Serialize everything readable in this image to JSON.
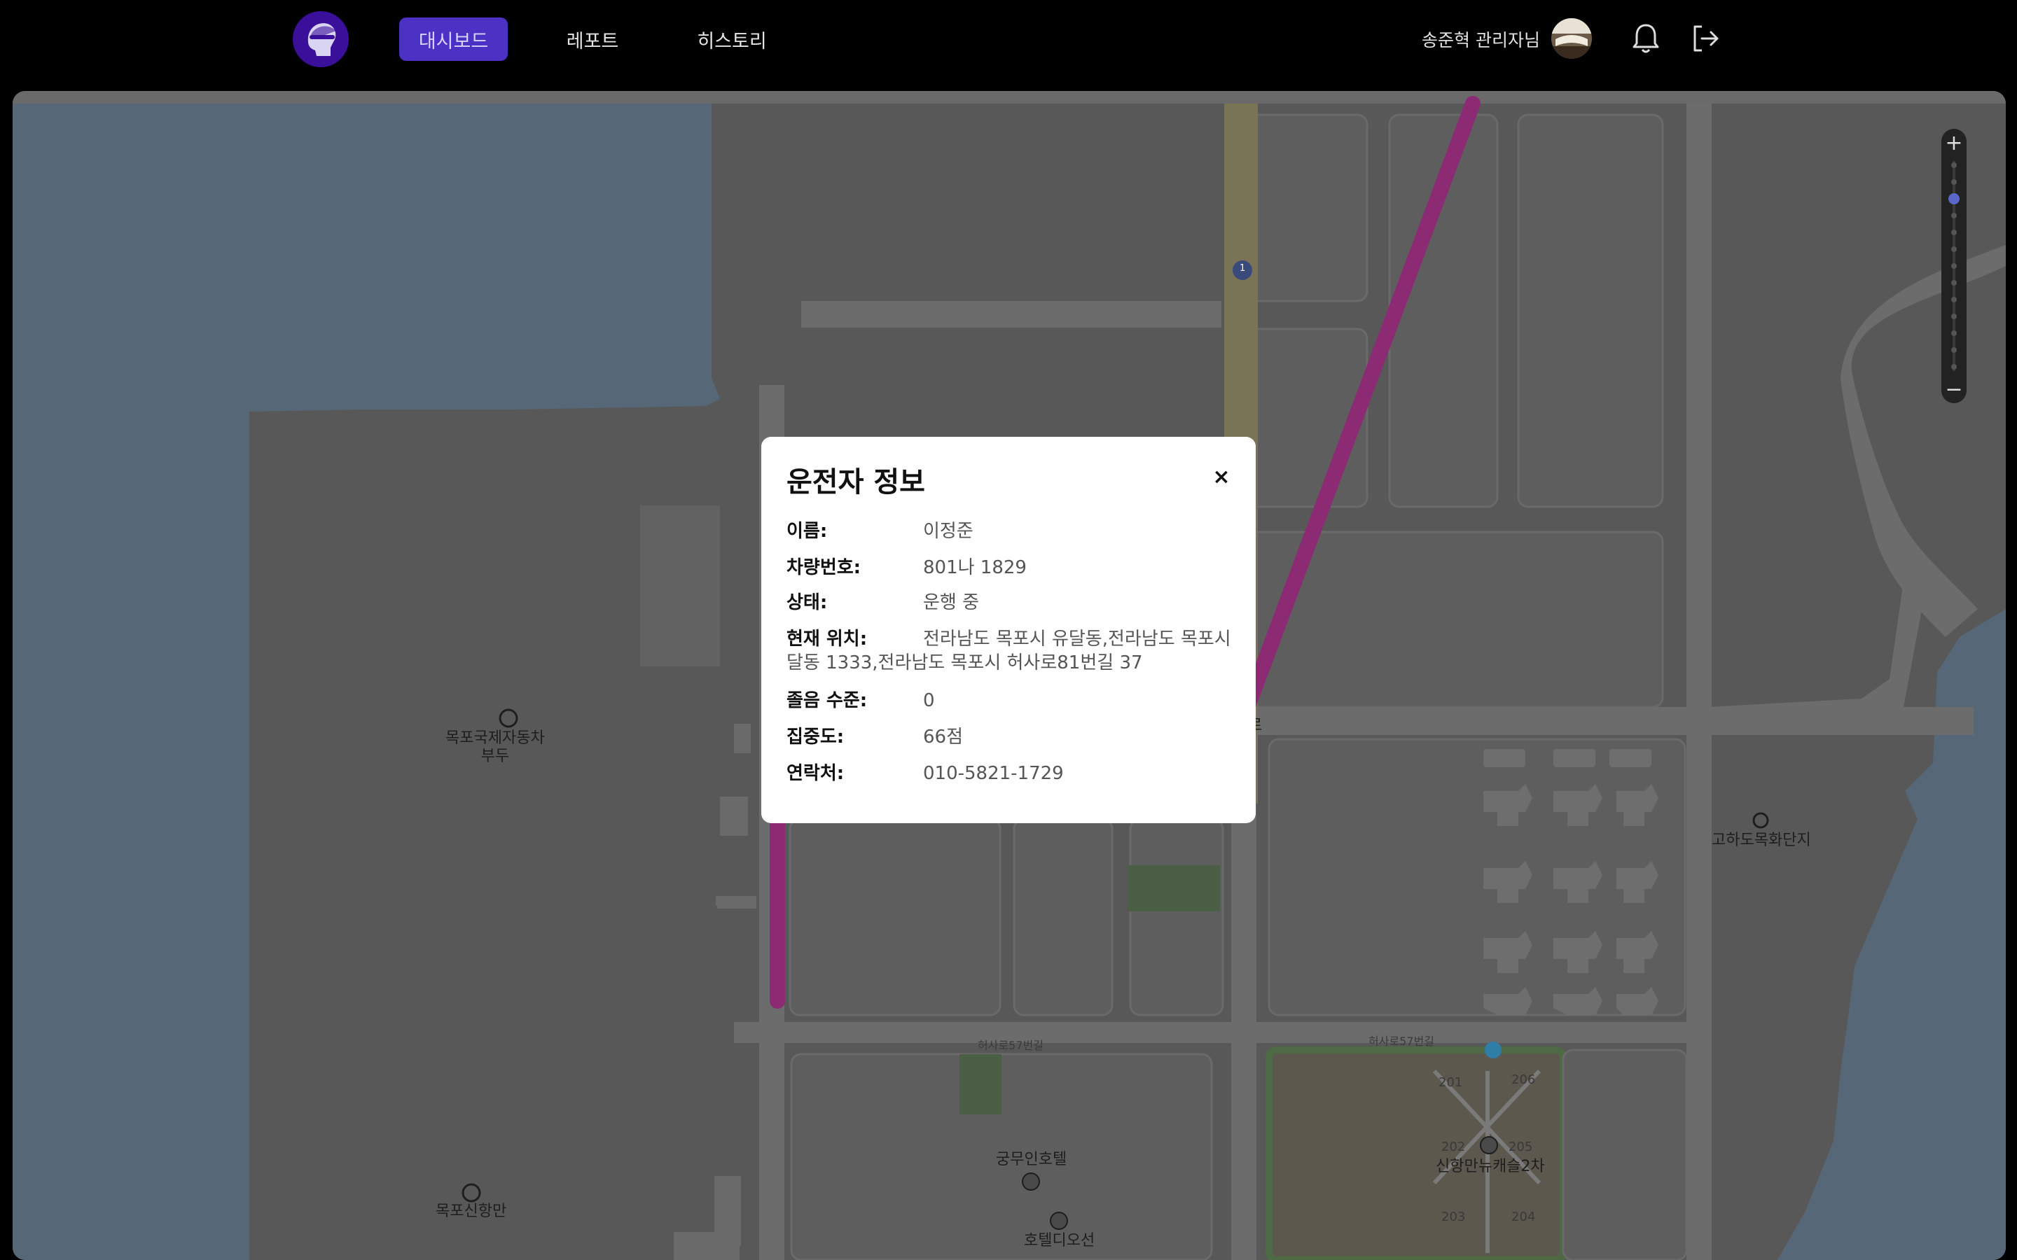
{
  "header": {
    "nav": [
      "대시보드",
      "레포트",
      "히스토리"
    ],
    "user_name": "송준혁 관리자님"
  },
  "map": {
    "labels": {
      "pier": "목포국제자동차\n부두",
      "port": "목포신항만",
      "complex": "고하도목화단지",
      "hotel1": "궁무인호텔",
      "hotel2": "호텔디오선",
      "apt": "신항만뉴캐슬2차",
      "street1": "허사로57번길",
      "street2": "허사로57번길",
      "road_frag": "로",
      "bldg_201": "201",
      "bldg_206": "206",
      "bldg_202": "202",
      "bldg_205": "205",
      "bldg_203": "203",
      "bldg_204": "204",
      "road_num": "1"
    },
    "zoom": {
      "plus": "+",
      "minus": "−"
    }
  },
  "modal": {
    "title": "운전자 정보",
    "close": "×",
    "fields": {
      "name_label": "이름:",
      "name_value": "이정준",
      "plate_label": "차량번호:",
      "plate_value": "801나 1829",
      "status_label": "상태:",
      "status_value": "운행 중",
      "location_label": "현재 위치:",
      "location_value": "전라남도 목포시 유달동,전라남도 목포시 달동 1333,전라남도 목포시 허사로81번길 37",
      "drowsy_label": "졸음 수준:",
      "drowsy_value": "0",
      "focus_label": "집중도:",
      "focus_value": "66점",
      "contact_label": "연락처:",
      "contact_value": "010-5821-1729"
    }
  },
  "colors": {
    "accent": "#4b31c4",
    "route": "#8c2a73",
    "water": "#5a6b7a"
  }
}
